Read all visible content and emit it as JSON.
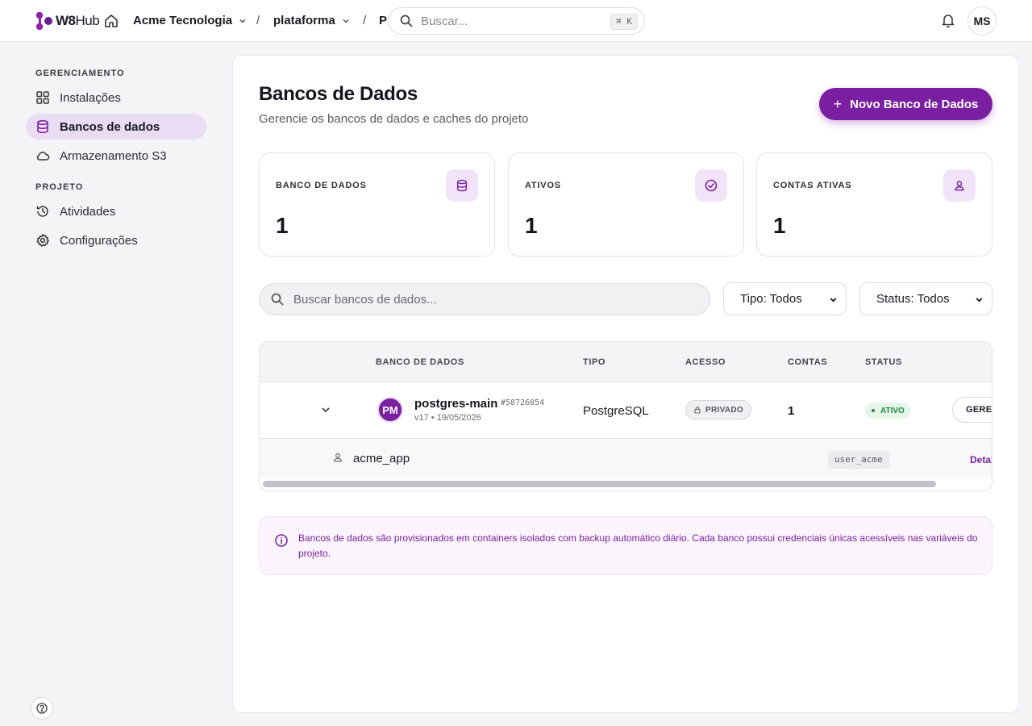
{
  "brand": {
    "name_bold": "W8",
    "name_thin": "Hub",
    "accent": "#7b1fa2"
  },
  "topbar": {
    "org": "Acme Tecnologia",
    "project": "plataforma",
    "crumb_partial": "P",
    "separator": "/",
    "search_placeholder": "Buscar...",
    "shortcut": "⌘ K",
    "avatar_initials": "MS"
  },
  "sidebar": {
    "sections": [
      {
        "title": "GERENCIAMENTO"
      },
      {
        "title": "PROJETO"
      }
    ],
    "items": [
      {
        "label": "Instalações",
        "icon": "grid-icon"
      },
      {
        "label": "Bancos de dados",
        "icon": "database-icon",
        "active": true
      },
      {
        "label": "Armazenamento S3",
        "icon": "cloud-icon"
      },
      {
        "label": "Atividades",
        "icon": "history-icon"
      },
      {
        "label": "Configurações",
        "icon": "gear-icon"
      }
    ]
  },
  "main": {
    "title": "Bancos de Dados",
    "subtitle": "Gerencie os bancos de dados e caches do projeto",
    "new_button": "Novo Banco de Dados"
  },
  "stats": [
    {
      "label": "BANCO DE DADOS",
      "value": "1",
      "icon": "database-icon"
    },
    {
      "label": "ATIVOS",
      "value": "1",
      "icon": "check-circle-icon"
    },
    {
      "label": "CONTAS ATIVAS",
      "value": "1",
      "icon": "user-icon"
    }
  ],
  "filters": {
    "search_placeholder": "Buscar bancos de dados...",
    "type_filter": "Tipo: Todos",
    "status_filter": "Status: Todos"
  },
  "table": {
    "columns": [
      "BANCO DE DADOS",
      "TIPO",
      "ACESSO",
      "CONTAS",
      "STATUS"
    ],
    "rows": [
      {
        "initials": "PM",
        "name": "postgres-main",
        "id": "#58726854",
        "meta": "v17 • 19/05/2026",
        "type": "PostgreSQL",
        "access": "PRIVADO",
        "accounts": "1",
        "status": "ATIVO",
        "action": "GERENCIAR",
        "account": {
          "name": "acme_app",
          "user": "user_acme",
          "link": "Detalhes"
        }
      }
    ]
  },
  "info": {
    "text": "Bancos de dados são provisionados em containers isolados com backup automático diário. Cada banco possui credenciais únicas acessíveis nas variáveis do projeto."
  }
}
